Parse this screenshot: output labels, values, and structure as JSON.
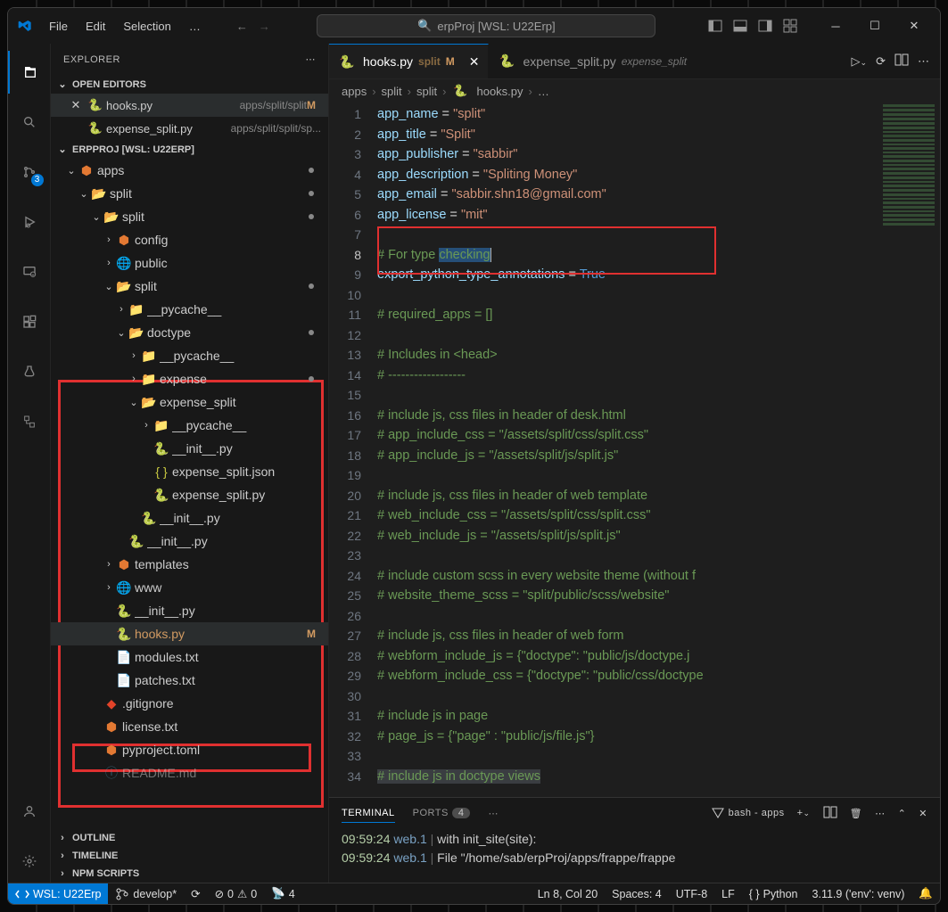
{
  "title": "erpProj [WSL: U22Erp]",
  "menu": [
    "File",
    "Edit",
    "Selection",
    "…"
  ],
  "explorer": {
    "title": "EXPLORER",
    "sections": {
      "openEditors": "OPEN EDITORS",
      "folder": "ERPPROJ [WSL: U22ERP]",
      "outline": "OUTLINE",
      "timeline": "TIMELINE",
      "npm": "NPM SCRIPTS"
    },
    "openEditors": [
      {
        "name": "hooks.py",
        "desc": "apps/split/split",
        "tag": "M",
        "close": true
      },
      {
        "name": "expense_split.py",
        "desc": "apps/split/split/sp..."
      }
    ],
    "tree": [
      {
        "d": 0,
        "tw": "v",
        "icon": "react",
        "label": "apps",
        "dot": true
      },
      {
        "d": 1,
        "tw": "v",
        "icon": "folderO",
        "label": "split",
        "dot": true
      },
      {
        "d": 2,
        "tw": "v",
        "icon": "folderO",
        "label": "split",
        "dot": true
      },
      {
        "d": 3,
        "tw": ">",
        "icon": "react",
        "label": "config"
      },
      {
        "d": 3,
        "tw": ">",
        "icon": "globe",
        "label": "public"
      },
      {
        "d": 3,
        "tw": "v",
        "icon": "folderO",
        "label": "split",
        "dot": true
      },
      {
        "d": 4,
        "tw": ">",
        "icon": "folderB",
        "label": "__pycache__"
      },
      {
        "d": 4,
        "tw": "v",
        "icon": "folderO",
        "label": "doctype",
        "dot": true
      },
      {
        "d": 5,
        "tw": ">",
        "icon": "folderB",
        "label": "__pycache__"
      },
      {
        "d": 5,
        "tw": ">",
        "icon": "folder",
        "label": "expense",
        "dot": true
      },
      {
        "d": 5,
        "tw": "v",
        "icon": "folderO",
        "label": "expense_split"
      },
      {
        "d": 6,
        "tw": ">",
        "icon": "folderB",
        "label": "__pycache__"
      },
      {
        "d": 6,
        "tw": "",
        "icon": "py",
        "label": "__init__.py"
      },
      {
        "d": 6,
        "tw": "",
        "icon": "json",
        "label": "expense_split.json"
      },
      {
        "d": 6,
        "tw": "",
        "icon": "py",
        "label": "expense_split.py"
      },
      {
        "d": 5,
        "tw": "",
        "icon": "py",
        "label": "__init__.py"
      },
      {
        "d": 4,
        "tw": "",
        "icon": "py",
        "label": "__init__.py"
      },
      {
        "d": 3,
        "tw": ">",
        "icon": "react",
        "label": "templates"
      },
      {
        "d": 3,
        "tw": ">",
        "icon": "globe",
        "label": "www"
      },
      {
        "d": 3,
        "tw": "",
        "icon": "py",
        "label": "__init__.py"
      },
      {
        "d": 3,
        "tw": "",
        "icon": "py",
        "label": "hooks.py",
        "sel": true,
        "tag": "M"
      },
      {
        "d": 3,
        "tw": "",
        "icon": "txt",
        "label": "modules.txt"
      },
      {
        "d": 3,
        "tw": "",
        "icon": "txt",
        "label": "patches.txt"
      },
      {
        "d": 2,
        "tw": "",
        "icon": "git",
        "label": ".gitignore"
      },
      {
        "d": 2,
        "tw": "",
        "icon": "react",
        "label": "license.txt"
      },
      {
        "d": 2,
        "tw": "",
        "icon": "react",
        "label": "pyproject.toml"
      },
      {
        "d": 2,
        "tw": "",
        "icon": "info",
        "label": "README.md",
        "faded": true
      }
    ]
  },
  "tabs": [
    {
      "name": "hooks.py",
      "desc": "split",
      "tag": "M",
      "active": true
    },
    {
      "name": "expense_split.py",
      "desc": "expense_split"
    }
  ],
  "breadcrumbs": [
    "apps",
    "split",
    "split",
    "hooks.py",
    "…"
  ],
  "code": {
    "lines": [
      [
        [
          "var",
          "app_name"
        ],
        [
          "op",
          " = "
        ],
        [
          "str",
          "\"split\""
        ]
      ],
      [
        [
          "var",
          "app_title"
        ],
        [
          "op",
          " = "
        ],
        [
          "str",
          "\"Split\""
        ]
      ],
      [
        [
          "var",
          "app_publisher"
        ],
        [
          "op",
          " = "
        ],
        [
          "str",
          "\"sabbir\""
        ]
      ],
      [
        [
          "var",
          "app_description"
        ],
        [
          "op",
          " = "
        ],
        [
          "str",
          "\"Spliting Money\""
        ]
      ],
      [
        [
          "var",
          "app_email"
        ],
        [
          "op",
          " = "
        ],
        [
          "str",
          "\"sabbir.shn18@gmail.com\""
        ]
      ],
      [
        [
          "var",
          "app_license"
        ],
        [
          "op",
          " = "
        ],
        [
          "str",
          "\"mit\""
        ]
      ],
      [],
      [
        [
          "com",
          "# For type "
        ],
        [
          "com-hl",
          "checking"
        ]
      ],
      [
        [
          "var",
          "export_python_type_annotations"
        ],
        [
          "op",
          " = "
        ],
        [
          "bool",
          "True"
        ]
      ],
      [],
      [
        [
          "com",
          "# required_apps = []"
        ]
      ],
      [],
      [
        [
          "com",
          "# Includes in <head>"
        ]
      ],
      [
        [
          "com",
          "# ------------------"
        ]
      ],
      [],
      [
        [
          "com",
          "# include js, css files in header of desk.html"
        ]
      ],
      [
        [
          "com",
          "# app_include_css = \"/assets/split/css/split.css\""
        ]
      ],
      [
        [
          "com",
          "# app_include_js = \"/assets/split/js/split.js\""
        ]
      ],
      [],
      [
        [
          "com",
          "# include js, css files in header of web template"
        ]
      ],
      [
        [
          "com",
          "# web_include_css = \"/assets/split/css/split.css\""
        ]
      ],
      [
        [
          "com",
          "# web_include_js = \"/assets/split/js/split.js\""
        ]
      ],
      [],
      [
        [
          "com",
          "# include custom scss in every website theme (without f"
        ]
      ],
      [
        [
          "com",
          "# website_theme_scss = \"split/public/scss/website\""
        ]
      ],
      [],
      [
        [
          "com",
          "# include js, css files in header of web form"
        ]
      ],
      [
        [
          "com",
          "# webform_include_js = {\"doctype\": \"public/js/doctype.j"
        ]
      ],
      [
        [
          "com",
          "# webform_include_css = {\"doctype\": \"public/css/doctype"
        ]
      ],
      [],
      [
        [
          "com",
          "# include js in page"
        ]
      ],
      [
        [
          "com",
          "# page_js = {\"page\" : \"public/js/file.js\"}"
        ]
      ],
      [],
      [
        [
          "com-f",
          "# include js in doctype views"
        ]
      ]
    ],
    "currentLine": 8
  },
  "terminal": {
    "tabs": [
      "TERMINAL",
      "PORTS"
    ],
    "portsCount": "4",
    "shell": "bash - apps",
    "lines": [
      {
        "t": "09:59:24",
        "s": "web.1",
        "text": "    with init_site(site):"
      },
      {
        "t": "09:59:24",
        "s": "web.1",
        "text": "  File \"/home/sab/erpProj/apps/frappe/frappe"
      }
    ]
  },
  "status": {
    "remote": "WSL: U22Erp",
    "branch": "develop*",
    "sync": "⟳",
    "errors": "0",
    "warnings": "0",
    "ports": "4",
    "lncol": "Ln 8, Col 20",
    "spaces": "Spaces: 4",
    "encoding": "UTF-8",
    "eol": "LF",
    "lang": "Python",
    "interp": "3.11.9 ('env': venv)"
  },
  "scmBadge": "3"
}
